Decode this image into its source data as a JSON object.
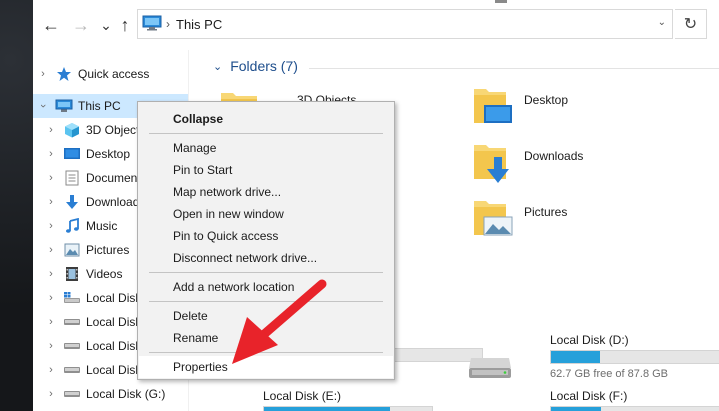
{
  "address": {
    "path": "This PC",
    "back_icon": "arrow-left-icon",
    "forward_icon": "arrow-right-icon",
    "up_icon": "arrow-up-icon",
    "refresh_icon": "refresh-icon"
  },
  "nav": {
    "items": [
      {
        "label": "Quick access",
        "icon": "star-icon"
      },
      {
        "label": "This PC",
        "icon": "monitor-icon"
      },
      {
        "label": "3D Objects",
        "icon": "cube-icon"
      },
      {
        "label": "Desktop",
        "icon": "desktop-icon"
      },
      {
        "label": "Documents",
        "icon": "document-icon"
      },
      {
        "label": "Downloads",
        "icon": "download-icon"
      },
      {
        "label": "Music",
        "icon": "music-icon"
      },
      {
        "label": "Pictures",
        "icon": "pictures-icon"
      },
      {
        "label": "Videos",
        "icon": "videos-icon"
      },
      {
        "label": "Local Disk",
        "icon": "windows-drive-icon"
      },
      {
        "label": "Local Disk",
        "icon": "drive-icon"
      },
      {
        "label": "Local Disk",
        "icon": "drive-icon"
      },
      {
        "label": "Local Disk",
        "icon": "drive-icon"
      },
      {
        "label": "Local Disk (G:)",
        "icon": "drive-icon"
      }
    ]
  },
  "content": {
    "folders_header": "Folders (7)",
    "folders": [
      {
        "label": "3D Objects"
      },
      {
        "label": "Desktop"
      },
      {
        "label": "Downloads"
      },
      {
        "label": "Pictures"
      }
    ],
    "drives": [
      {
        "label": "Local Disk (D:)",
        "free": "62.7 GB free of 87.8 GB",
        "used_fraction": 0.29
      },
      {
        "label": "Local Disk (E:)",
        "used_fraction": 0.55
      },
      {
        "label": "Local Disk (F:)",
        "used_fraction": 0.3
      }
    ]
  },
  "context_menu": {
    "items": [
      "Collapse",
      "Manage",
      "Pin to Start",
      "Map network drive...",
      "Open in new window",
      "Pin to Quick access",
      "Disconnect network drive...",
      "Add a network location",
      "Delete",
      "Rename",
      "Properties"
    ]
  },
  "colors": {
    "selection": "#cce8ff",
    "accent_blue": "#26a0da",
    "header_blue": "#1e4e8c",
    "arrow_red": "#e8232a",
    "folder_yellow": "#f8d775"
  }
}
